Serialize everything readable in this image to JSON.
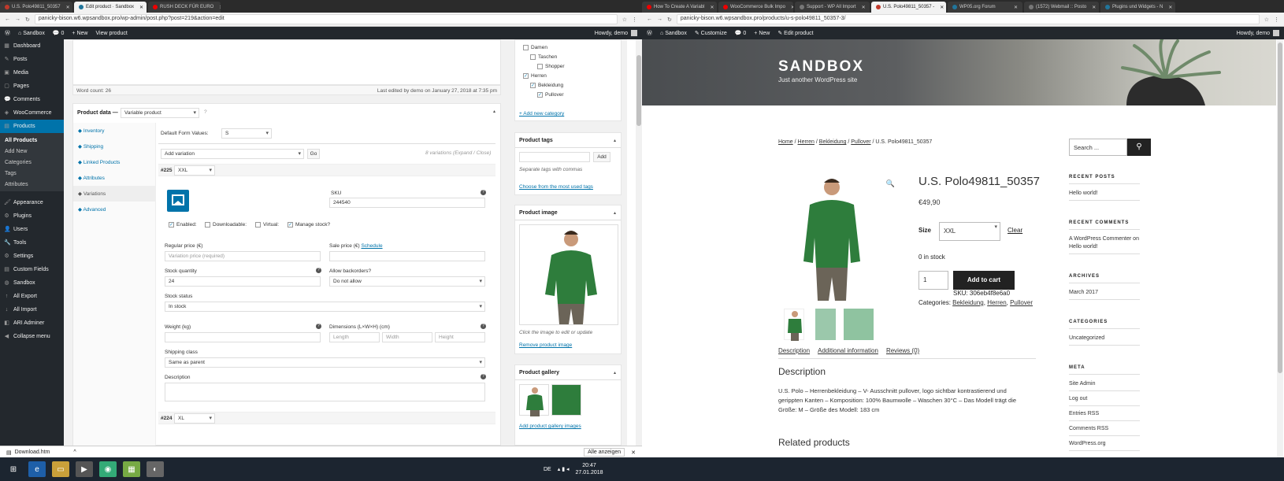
{
  "left_browser": {
    "tabs": [
      {
        "title": "U.S. Polo49811_50357",
        "active": false,
        "favicon": "#c0392b"
      },
      {
        "title": "Edit product · Sandbox",
        "active": true,
        "favicon": "#21759b"
      },
      {
        "title": "RUSH DECK FÜR EURO",
        "active": false,
        "favicon": "#e00"
      }
    ],
    "url": "panicky-bison.w6.wpsandbox.pro/wp-admin/post.php?post=219&action=edit"
  },
  "right_browser": {
    "tabs": [
      {
        "title": "How To Create A Variabl",
        "active": false,
        "favicon": "#e00"
      },
      {
        "title": "WooCommerce Bulk Impo",
        "active": false,
        "favicon": "#e00"
      },
      {
        "title": "Support - WP All Import",
        "active": false,
        "favicon": "#777"
      },
      {
        "title": "U.S. Polo49811_50357 -",
        "active": true,
        "favicon": "#c0392b"
      },
      {
        "title": "WP05.org Forum",
        "active": false,
        "favicon": "#21759b"
      },
      {
        "title": "(1572) Webmail :: Posto",
        "active": false,
        "favicon": "#777"
      },
      {
        "title": "Plugins und Widgets - N",
        "active": false,
        "favicon": "#21759b"
      }
    ],
    "url": "panicky-bison.w6.wpsandbox.pro/products/u-s-polo49811_50357-3/"
  },
  "adminbar_left": {
    "site": "Sandbox",
    "comments": "0",
    "new": "New",
    "view": "View product",
    "howdy": "Howdy, demo"
  },
  "adminbar_right": {
    "site": "Sandbox",
    "customize": "Customize",
    "comments": "0",
    "new": "New",
    "edit": "Edit product",
    "howdy": "Howdy, demo"
  },
  "sidebar": {
    "items": [
      "Dashboard",
      "Posts",
      "Media",
      "Pages",
      "Comments",
      "WooCommerce",
      "Products"
    ],
    "products_sub": [
      "All Products",
      "Add New",
      "Categories",
      "Tags",
      "Attributes"
    ],
    "items2": [
      "Appearance",
      "Plugins",
      "Users",
      "Tools",
      "Settings",
      "Custom Fields",
      "Sandbox",
      "All Export",
      "All Import",
      "ARI Adminer",
      "Collapse menu"
    ]
  },
  "editor": {
    "word_count": "Word count: 26",
    "last_edited": "Last edited by demo on January 27, 2018 at 7:35 pm"
  },
  "product_data": {
    "label": "Product data —",
    "type": "Variable product",
    "tabs": [
      "Inventory",
      "Shipping",
      "Linked Products",
      "Attributes",
      "Variations",
      "Advanced"
    ],
    "default_form_label": "Default Form Values:",
    "default_form_value": "S",
    "add_variation": "Add variation",
    "go": "Go",
    "variations_info": "8 variations (Expand / Close)",
    "var1_id": "#225",
    "var1_size": "XXL",
    "sku_label": "SKU",
    "sku_value": "244540",
    "enabled": "Enabled:",
    "downloadable": "Downloadable:",
    "virtual": "Virtual:",
    "manage_stock": "Manage stock?",
    "regular_price_label": "Regular price (€)",
    "regular_price_ph": "Variation price (required)",
    "sale_price_label": "Sale price (€)",
    "schedule": "Schedule",
    "stock_qty_label": "Stock quantity",
    "stock_qty": "24",
    "backorders_label": "Allow backorders?",
    "backorders": "Do not allow",
    "stock_status_label": "Stock status",
    "stock_status": "In stock",
    "weight_label": "Weight (kg)",
    "dimensions_label": "Dimensions (L×W×H) (cm)",
    "length": "Length",
    "width": "Width",
    "height": "Height",
    "shipping_class_label": "Shipping class",
    "shipping_class": "Same as parent",
    "description_label": "Description",
    "var2_id": "#224",
    "var2_size": "XL"
  },
  "categories_box": {
    "items": [
      "Damen",
      "Taschen",
      "Shopper",
      "Herren",
      "Bekleidung",
      "Pullover"
    ],
    "add_new": "+ Add new category"
  },
  "tags_box": {
    "title": "Product tags",
    "add": "Add",
    "hint": "Separate tags with commas",
    "choose": "Choose from the most used tags"
  },
  "image_box": {
    "title": "Product image",
    "hint": "Click the image to edit or update",
    "remove": "Remove product image"
  },
  "gallery_box": {
    "title": "Product gallery",
    "add": "Add product gallery images"
  },
  "download_bar": {
    "file": "Download.htm",
    "show_all": "Alle anzeigen"
  },
  "taskbar": {
    "lang": "DE",
    "time": "20:47",
    "date": "27.01.2018"
  },
  "store": {
    "site_title": "SANDBOX",
    "tagline": "Just another WordPress site",
    "breadcrumb": [
      "Home",
      "Herren",
      "Bekleidung",
      "Pullover"
    ],
    "breadcrumb_current": "U.S. Polo49811_50357",
    "product_title": "U.S. Polo49811_50357",
    "price": "€49,90",
    "size_label": "Size",
    "size_value": "XXL",
    "clear": "Clear",
    "stock": "0 in stock",
    "qty": "1",
    "add_to_cart": "Add to cart",
    "sku": "SKU: 306eb4f8e6a0",
    "categories_label": "Categories:",
    "categories": [
      "Bekleidung",
      "Herren",
      "Pullover"
    ],
    "tabs": [
      "Description",
      "Additional information",
      "Reviews (0)"
    ],
    "desc_heading": "Description",
    "desc_text": "U.S. Polo – Herrenbekleidung – V- Ausschnitt pullover, logo sichtbar kontrastierend und gerippten Kanten – Komposition: 100% Baumwolle – Waschen 30°C – Das Modell trägt die Größe: M – Größe des Modell: 183 cm",
    "related": "Related products",
    "search_ph": "Search ...",
    "widgets": [
      {
        "title": "RECENT POSTS",
        "links": [
          "Hello world!"
        ]
      },
      {
        "title": "RECENT COMMENTS",
        "links": [
          "A WordPress Commenter on Hello world!"
        ]
      },
      {
        "title": "ARCHIVES",
        "links": [
          "March 2017"
        ]
      },
      {
        "title": "CATEGORIES",
        "links": [
          "Uncategorized"
        ]
      },
      {
        "title": "META",
        "links": [
          "Site Admin",
          "Log out",
          "Entries RSS",
          "Comments RSS",
          "WordPress.org"
        ]
      }
    ]
  }
}
